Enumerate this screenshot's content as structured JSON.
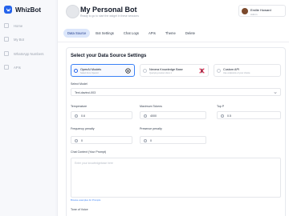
{
  "brand": {
    "name": "WhizBot"
  },
  "sidebar": {
    "items": [
      {
        "label": "Home",
        "icon": "home-icon"
      },
      {
        "label": "My Bot",
        "icon": "bot-icon"
      },
      {
        "label": "WhatsApp Numbers",
        "icon": "phone-icon"
      },
      {
        "label": "APIs",
        "icon": "api-icon"
      }
    ]
  },
  "header": {
    "title": "My Personal Bot",
    "subtitle": "Ready to go to start the widget in these sessions"
  },
  "user": {
    "name": "Emilie Howard",
    "role": "Admin"
  },
  "tabs": [
    "Data Source",
    "Bot Settings",
    "Chat Logs",
    "APIs",
    "Theme",
    "Delete"
  ],
  "active_tab": "Data Source",
  "settings": {
    "section_title": "Select your Data Source Settings",
    "sources": [
      {
        "name": "OpenAI Models",
        "desc": "Select from OpenAI",
        "selected": true,
        "logo": "openai-logo-icon"
      },
      {
        "name": "Nexera Knowledge Base",
        "desc": "Querying custom docs 1",
        "selected": false,
        "logo": "nexera-logo-icon"
      },
      {
        "name": "Custom API",
        "desc": "Use endpoints of your choice",
        "selected": false,
        "logo": ""
      }
    ],
    "model": {
      "label": "Select Model",
      "value": "Text-davinci-003"
    },
    "temperature": {
      "label": "Temperature",
      "value": "0.6"
    },
    "max_tokens": {
      "label": "Maximum Tokens",
      "value": "4000"
    },
    "top_p": {
      "label": "Top P",
      "value": "0.5"
    },
    "frequency_penalty": {
      "label": "Frequency penalty",
      "value": "0"
    },
    "presence_penalty": {
      "label": "Presence penalty",
      "value": "0"
    },
    "chat_context": {
      "label": "Chat Context (Your Prompt)",
      "placeholder": "Enter your knowledgebase here",
      "hint": "Browse examples for Prompts"
    },
    "tone_label": "Tone of Voice"
  },
  "colors": {
    "accent": "#2563eb",
    "active_tab_bg": "#dbe6fb"
  }
}
